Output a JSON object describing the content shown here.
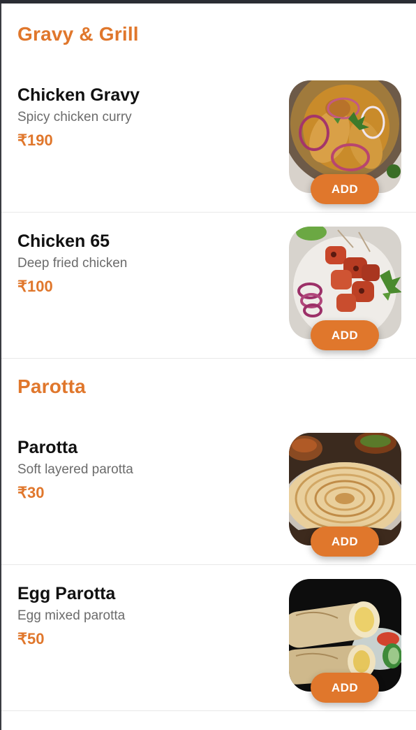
{
  "colors": {
    "accent": "#e0772c",
    "item_name": "#111111",
    "item_desc": "#6b6b6b",
    "divider": "#e8e8e8"
  },
  "sections": [
    {
      "title": "Gravy & Grill",
      "items": [
        {
          "name": "Chicken Gravy",
          "description": "Spicy chicken curry",
          "price": "₹190",
          "add_label": "ADD",
          "image": "chicken-gravy-photo"
        },
        {
          "name": "Chicken 65",
          "description": "Deep fried chicken",
          "price": "₹100",
          "add_label": "ADD",
          "image": "chicken-65-photo"
        }
      ]
    },
    {
      "title": "Parotta",
      "items": [
        {
          "name": "Parotta",
          "description": "Soft layered parotta",
          "price": "₹30",
          "add_label": "ADD",
          "image": "parotta-photo"
        },
        {
          "name": "Egg Parotta",
          "description": "Egg mixed parotta",
          "price": "₹50",
          "add_label": "ADD",
          "image": "egg-parotta-photo"
        }
      ]
    }
  ]
}
